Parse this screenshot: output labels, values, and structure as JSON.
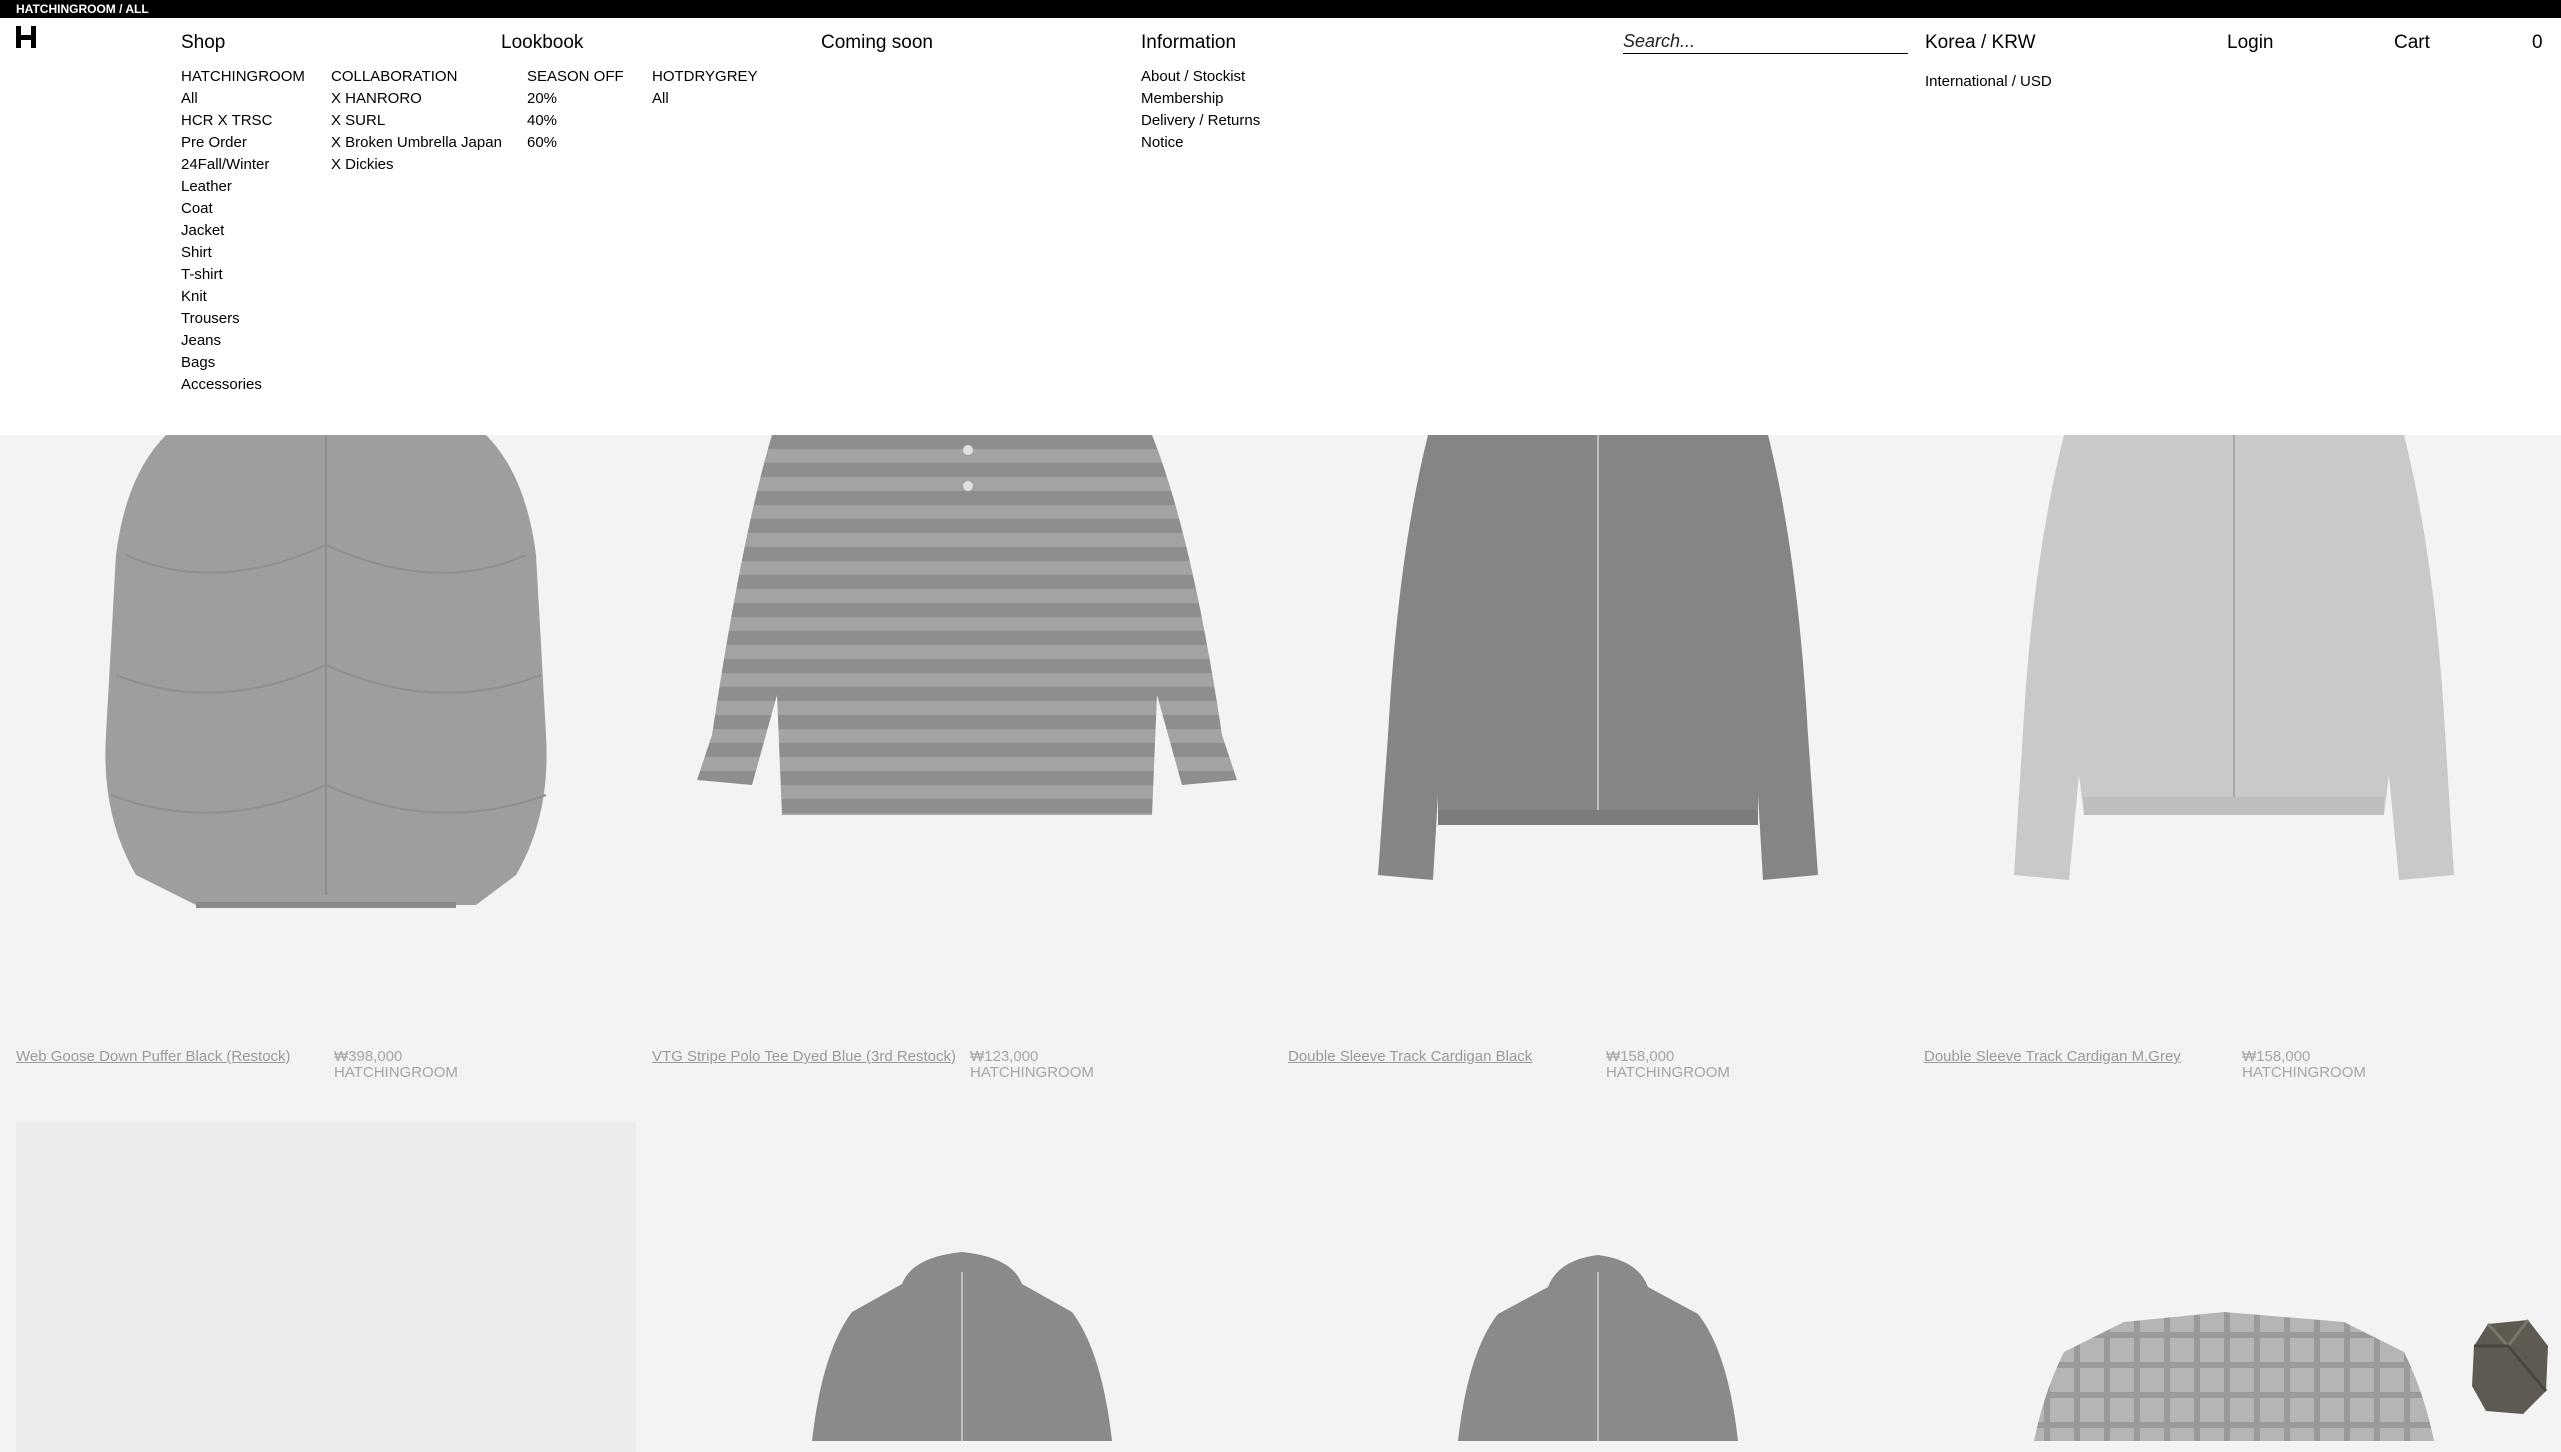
{
  "breadcrumb": "HATCHINGROOM / ALL",
  "nav": {
    "shop": "Shop",
    "lookbook": "Lookbook",
    "coming_soon": "Coming soon",
    "information": "Information",
    "search_placeholder": "Search...",
    "region": "Korea / KRW",
    "region_alt": "International / USD",
    "login": "Login",
    "cart": "Cart",
    "cart_count": "0"
  },
  "menu": {
    "hatchingroom": {
      "heading": "HATCHINGROOM",
      "items": [
        "All",
        "HCR X TRSC",
        "Pre Order",
        "24Fall/Winter",
        "Leather",
        "Coat",
        "Jacket",
        "Shirt",
        "T-shirt",
        "Knit",
        "Trousers",
        "Jeans",
        "Bags",
        "Accessories"
      ]
    },
    "collaboration": {
      "heading": "COLLABORATION",
      "items": [
        "X HANRORO",
        "X SURL",
        "X Broken Umbrella Japan",
        "X Dickies"
      ]
    },
    "season_off": {
      "heading": "SEASON OFF",
      "items": [
        "20%",
        "40%",
        "60%"
      ]
    },
    "hotdrygrey": {
      "heading": "HOTDRYGREY",
      "items": [
        "All"
      ]
    },
    "information": {
      "items": [
        "About / Stockist",
        "Membership",
        "Delivery / Returns",
        "Notice"
      ]
    }
  },
  "products": [
    {
      "name": "Web Goose Down Puffer Black (Restock)",
      "price": "₩398,000",
      "brand": "HATCHINGROOM"
    },
    {
      "name": "VTG Stripe Polo Tee Dyed Blue (3rd Restock)",
      "price": "₩123,000",
      "brand": "HATCHINGROOM"
    },
    {
      "name": "Double Sleeve Track Cardigan Black",
      "price": "₩158,000",
      "brand": "HATCHINGROOM"
    },
    {
      "name": "Double Sleeve Track Cardigan M.Grey",
      "price": "₩158,000",
      "brand": "HATCHINGROOM"
    }
  ],
  "colors": {
    "topbar": "#000000",
    "page_bg": "#f3f3f3",
    "menu_bg": "#ffffff",
    "muted_text": "#9a9a9a"
  }
}
